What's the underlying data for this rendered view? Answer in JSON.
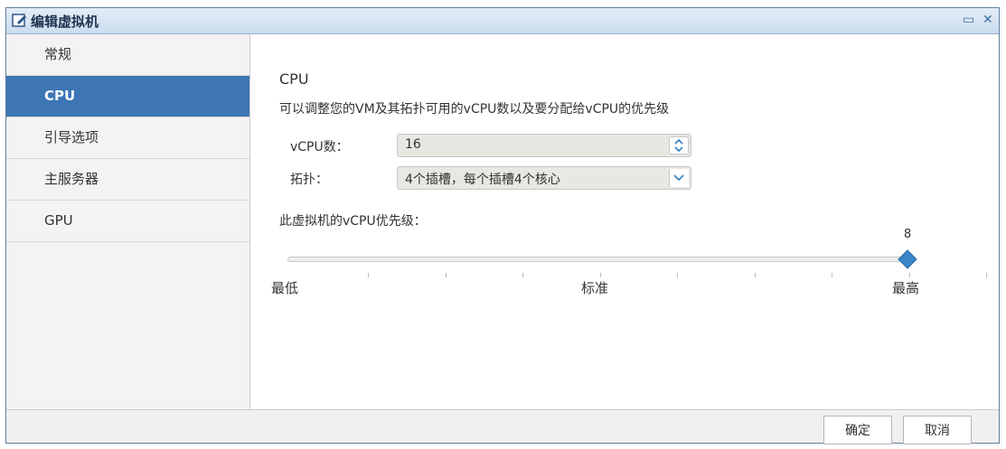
{
  "window": {
    "title": "编辑虚拟机"
  },
  "sidebar": {
    "items": [
      {
        "label": "常规"
      },
      {
        "label": "CPU"
      },
      {
        "label": "引导选项"
      },
      {
        "label": "主服务器"
      },
      {
        "label": "GPU"
      }
    ],
    "active": "CPU"
  },
  "cpu": {
    "title": "CPU",
    "description": "可以调整您的VM及其拓扑可用的vCPU数以及要分配给vCPU的优先级",
    "vcpu_label": "vCPU数：",
    "vcpu_value": "16",
    "topology_label": "拓扑：",
    "topology_value": "4个插槽，每个插槽4个核心",
    "priority_label": "此虚拟机的vCPU优先级：",
    "priority_value": "8",
    "priority_fraction": 1.0,
    "slider_min_label": "最低",
    "slider_mid_label": "标准",
    "slider_max_label": "最高"
  },
  "buttons": {
    "ok": "确定",
    "cancel": "取消"
  },
  "colors": {
    "accent": "#3d75b5",
    "thumb": "#3a86c8"
  }
}
